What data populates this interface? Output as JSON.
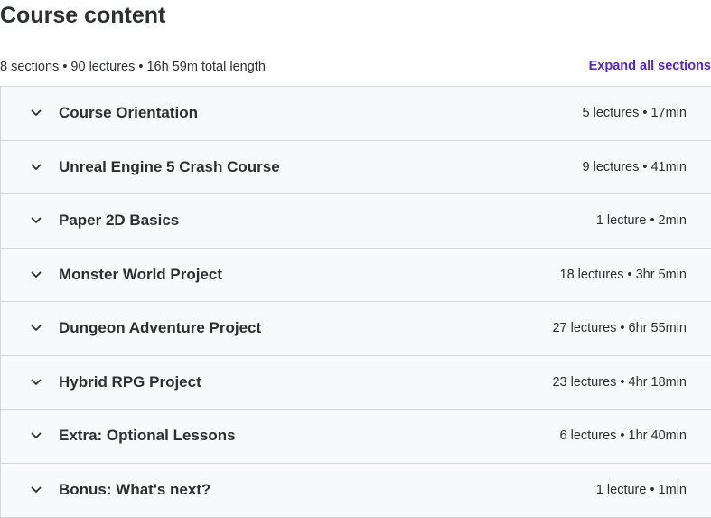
{
  "header": {
    "title": "Course content",
    "summary": "8 sections • 90 lectures • 16h 59m total length",
    "expand_label": "Expand all sections"
  },
  "icons": {
    "section_toggle": "chevron-down-icon"
  },
  "colors": {
    "accent": "#5624d0",
    "text": "#2d2f31",
    "section_bg": "#f7f9fa",
    "border": "#d1d7dc"
  },
  "sections": [
    {
      "title": "Course Orientation",
      "info": "5 lectures • 17min"
    },
    {
      "title": "Unreal Engine 5 Crash Course",
      "info": "9 lectures • 41min"
    },
    {
      "title": "Paper 2D Basics",
      "info": "1 lecture • 2min"
    },
    {
      "title": "Monster World Project",
      "info": "18 lectures • 3hr 5min"
    },
    {
      "title": "Dungeon Adventure Project",
      "info": "27 lectures • 6hr 55min"
    },
    {
      "title": "Hybrid RPG Project",
      "info": "23 lectures • 4hr 18min"
    },
    {
      "title": "Extra: Optional Lessons",
      "info": "6 lectures • 1hr 40min"
    },
    {
      "title": "Bonus: What's next?",
      "info": "1 lecture • 1min"
    }
  ]
}
